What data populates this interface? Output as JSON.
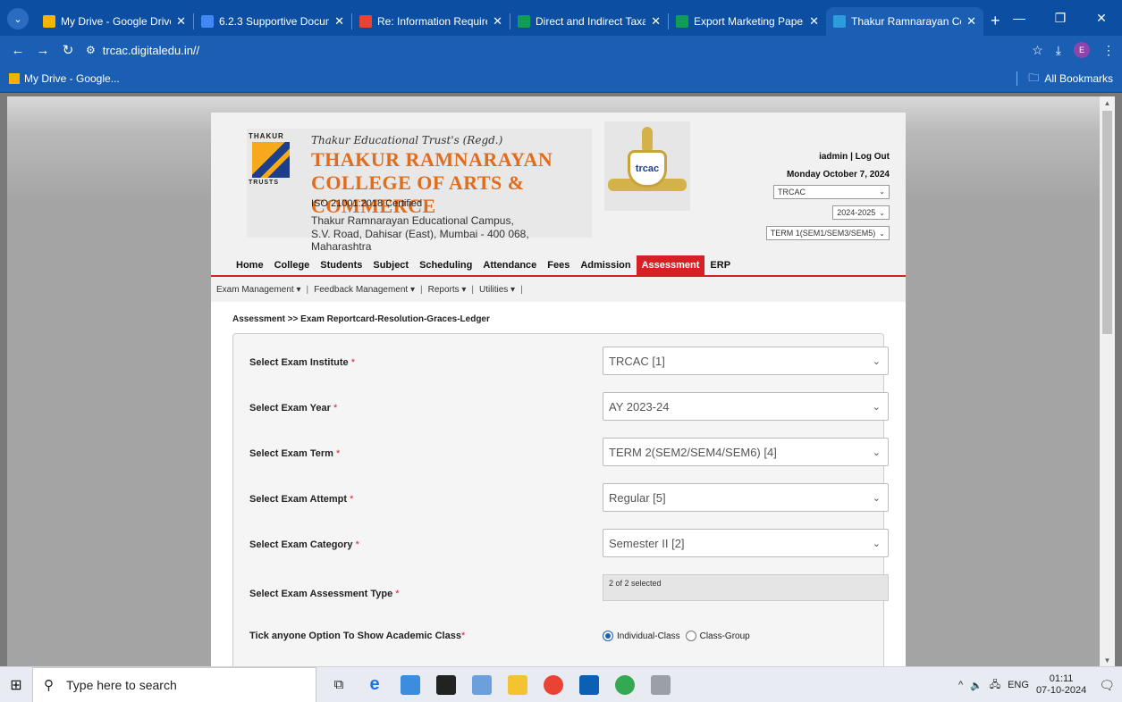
{
  "browser": {
    "tabs": [
      {
        "label": "My Drive - Google Drive",
        "color": "#f4b400"
      },
      {
        "label": "6.2.3 Supportive Docum",
        "color": "#4285f4"
      },
      {
        "label": "Re: Information Require",
        "color": "#ea4335"
      },
      {
        "label": "Direct and Indirect Taxat",
        "color": "#0f9d58"
      },
      {
        "label": "Export Marketing Paper",
        "color": "#0f9d58"
      },
      {
        "label": "Thakur Ramnarayan Col",
        "color": "#2d9cdb"
      }
    ],
    "close_glyph": "✕",
    "new_tab": "+",
    "url": "trcac.digitaledu.in//",
    "bookmark": "My Drive - Google...",
    "all_bookmarks": "All Bookmarks",
    "profile_initial": "E"
  },
  "header": {
    "trust_top": "THAKUR",
    "trust_bottom": "TRUSTS",
    "trust_name": "Thakur Educational Trust's (Regd.)",
    "college_line1": "THAKUR RAMNARAYAN",
    "college_line2": "COLLEGE OF ARTS & COMMERCE",
    "iso": "ISO 21001:2018 Certified",
    "address1": "Thakur Ramnarayan Educational Campus,",
    "address2": "S.V. Road, Dahisar (East), Mumbai - 400 068, Maharashtra",
    "crest_text": "trcac",
    "user": "iadmin",
    "separator": "|",
    "logout": "Log Out",
    "date": "Monday October 7, 2024",
    "institute_select": "TRCAC",
    "year_select": "2024-2025",
    "term_select": "TERM 1(SEM1/SEM3/SEM5)"
  },
  "mainnav": [
    "Home",
    "College",
    "Students",
    "Subject",
    "Scheduling",
    "Attendance",
    "Fees",
    "Admission",
    "Assessment",
    "ERP"
  ],
  "subnav": [
    "Exam Management ▾",
    "Feedback Management ▾",
    "Reports ▾",
    "Utilities ▾"
  ],
  "breadcrumb": "Assessment >> Exam Reportcard-Resolution-Graces-Ledger",
  "form": {
    "required_mark": "*",
    "institute_label": "Select Exam Institute",
    "institute_value": "TRCAC [1]",
    "year_label": "Select Exam Year",
    "year_value": "AY 2023-24",
    "term_label": "Select Exam Term",
    "term_value": "TERM 2(SEM2/SEM4/SEM6) [4]",
    "attempt_label": "Select Exam Attempt",
    "attempt_value": "Regular [5]",
    "category_label": "Select Exam Category",
    "category_value": "Semester II [2]",
    "assessment_label": "Select Exam Assessment Type",
    "assessment_value": "2 of 2 selected",
    "class_option_label": "Tick anyone Option To Show Academic Class",
    "radio_individual": "Individual-Class",
    "radio_group": "Class-Group"
  },
  "taskbar": {
    "search_placeholder": "Type here to search",
    "lang": "ENG",
    "time": "01:11",
    "date": "07-10-2024"
  },
  "colors": {
    "chrome_blue": "#1a5fb4",
    "nav_red": "#d71f26",
    "college_orange": "#e06c1c"
  }
}
